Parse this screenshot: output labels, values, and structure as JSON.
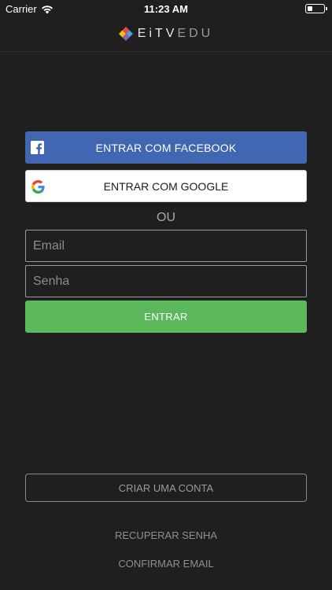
{
  "status_bar": {
    "carrier": "Carrier",
    "time": "11:23 AM",
    "wifi_icon": "wifi-icon",
    "battery_icon": "battery-icon"
  },
  "header": {
    "logo_icon": "eitv-diamond-logo-icon",
    "logo_bold": "EiTV",
    "logo_light": "EDU"
  },
  "social": {
    "facebook_label": "ENTRAR COM FACEBOOK",
    "facebook_icon": "facebook-icon",
    "google_label": "ENTRAR COM GOOGLE",
    "google_icon": "google-icon"
  },
  "divider_label": "OU",
  "form": {
    "email_placeholder": "Email",
    "email_value": "",
    "password_placeholder": "Senha",
    "password_value": "",
    "login_label": "ENTRAR"
  },
  "footer": {
    "signup_label": "CRIAR UMA CONTA",
    "recover_label": "RECUPERAR SENHA",
    "confirm_label": "CONFIRMAR EMAIL"
  },
  "colors": {
    "background": "#1f1f1f",
    "facebook": "#4267b2",
    "login_green": "#5bb85b",
    "google_blue": "#4285f4",
    "google_red": "#ea4335",
    "google_yellow": "#fbbc05",
    "google_green": "#34a853"
  }
}
